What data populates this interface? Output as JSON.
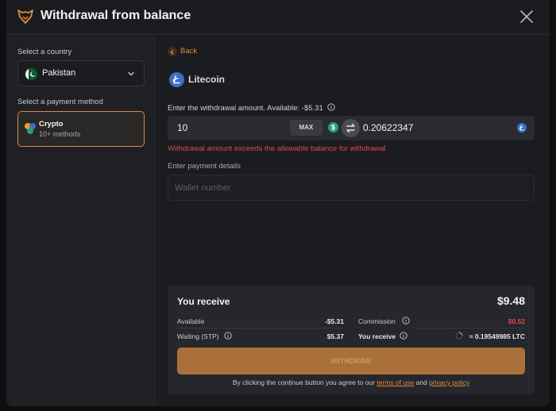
{
  "header": {
    "title": "Withdrawal from balance",
    "logo_icon": "fox-logo-icon",
    "close_icon": "close-icon"
  },
  "sidebar": {
    "country_label": "Select a country",
    "country_value": "Pakistan",
    "method_label": "Select a payment method",
    "method": {
      "name": "Crypto",
      "sub": "10+ methods"
    }
  },
  "main": {
    "back_label": "Back",
    "coin_name": "Litecoin",
    "amount_label": "Enter the withdrawal amount. Available: -$5.31",
    "amount_value": "10",
    "max_label": "MAX",
    "crypto_amount": "0.20622347",
    "error_text": "Withdrawal amount exceeds the allowable balance for withdrawal",
    "payment_label": "Enter payment details",
    "wallet_placeholder": "Wallet number"
  },
  "summary": {
    "title": "You receive",
    "total": "$9.48",
    "available_label": "Available",
    "available_value": "-$5.31",
    "commission_label": "Commission",
    "commission_value": "$0.52",
    "waiting_label": "Waiting (STP)",
    "waiting_value": "$5.37",
    "receive_label": "You receive",
    "receive_value": "≈ 0.19549985 LTC",
    "button_label": "WITHDRAW",
    "agree_prefix": "By clicking the continue button you agree to our",
    "terms_link": "terms of use",
    "and_text": "and",
    "privacy_link": "privacy policy"
  },
  "colors": {
    "accent": "#e08a3a",
    "error": "#e04848",
    "litecoin": "#3d6fc9",
    "usd": "#26a17b"
  }
}
